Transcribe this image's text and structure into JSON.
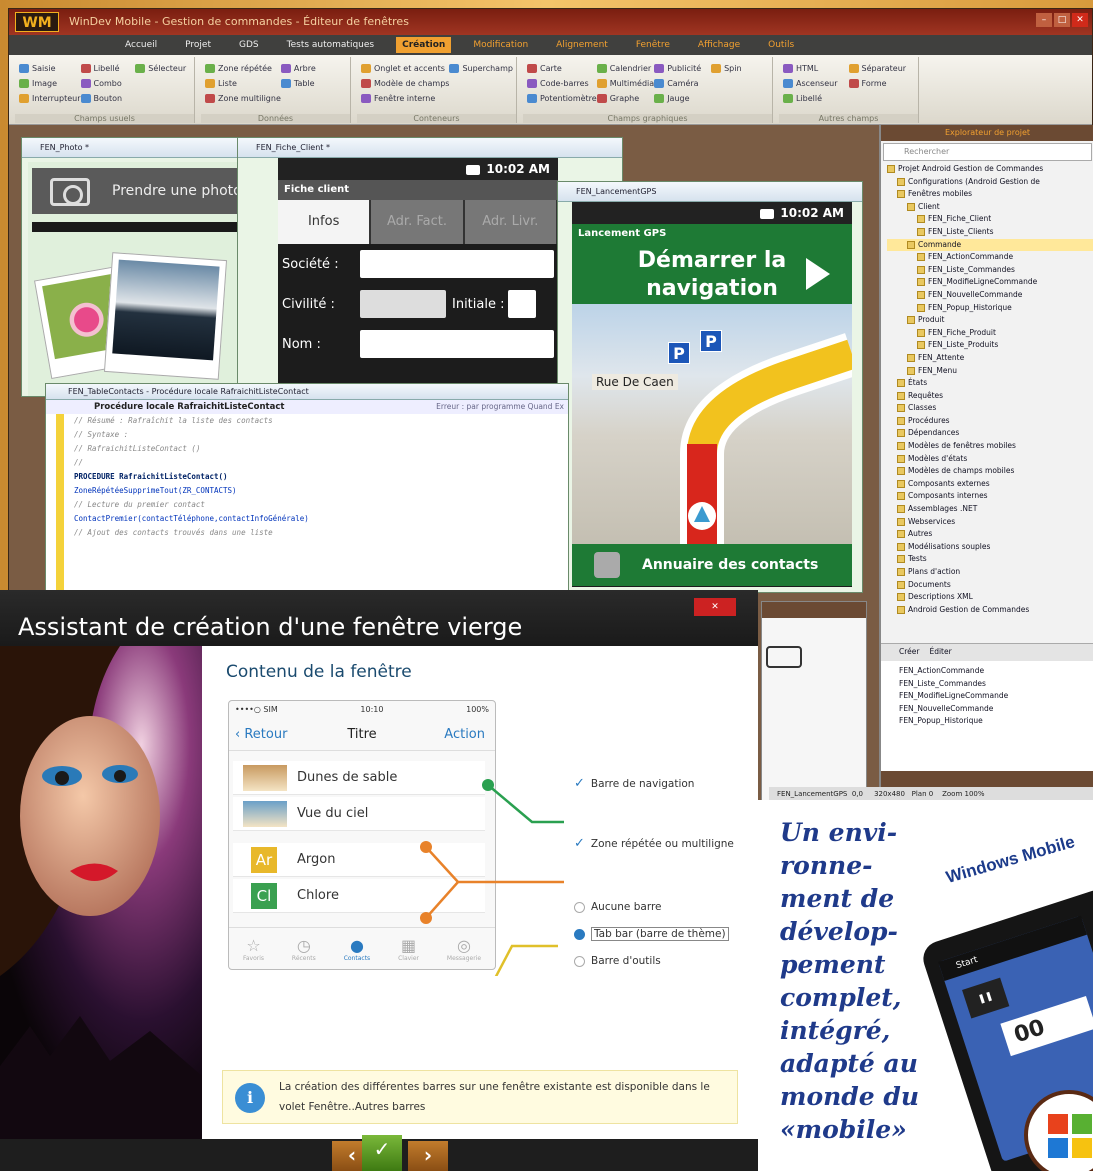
{
  "ide": {
    "title": "WinDev Mobile - Gestion de commandes - Éditeur de fenêtres",
    "logo": "WM",
    "menu": [
      "Accueil",
      "Projet",
      "GDS",
      "Tests automatiques",
      "Création",
      "Modification",
      "Alignement",
      "Fenêtre",
      "Affichage",
      "Outils"
    ],
    "active_menu": "Création",
    "ribbon_groups": [
      {
        "title": "Champs usuels",
        "items": [
          "Saisie",
          "Image",
          "Interrupteur",
          "Libellé",
          "Combo",
          "Bouton",
          "Sélecteur"
        ]
      },
      {
        "title": "Données",
        "items": [
          "Zone répétée",
          "Liste",
          "Zone multiligne",
          "Arbre",
          "Table"
        ]
      },
      {
        "title": "Conteneurs",
        "items": [
          "Onglet et accents",
          "Modèle de champs",
          "Fenêtre interne",
          "Superchamp"
        ]
      },
      {
        "title": "Champs graphiques",
        "items": [
          "Carte",
          "Code-barres",
          "Potentiomètre",
          "Calendrier",
          "Multimédia",
          "Graphe",
          "Publicité",
          "Caméra",
          "Jauge",
          "Spin"
        ]
      },
      {
        "title": "Autres champs",
        "items": [
          "HTML",
          "Ascenseur",
          "Libellé",
          "Séparateur",
          "Forme"
        ]
      }
    ]
  },
  "windows": {
    "photo": {
      "title": "FEN_Photo *",
      "camera_label": "Prendre une photo"
    },
    "client": {
      "title": "FEN_Fiche_Client *",
      "time": "10:02 AM",
      "appbar": "Fiche client",
      "tabs": [
        "Infos",
        "Adr. Fact.",
        "Adr. Livr."
      ],
      "fields": [
        "Société :",
        "Civilité :",
        "Nom :"
      ],
      "initiale": "Initiale :"
    },
    "gps": {
      "title": "FEN_LancementGPS",
      "time": "10:02 AM",
      "appbar": "Lancement GPS",
      "button_line1": "Démarrer la",
      "button_line2": "navigation",
      "street": "Rue De Caen",
      "contacts": "Annuaire des contacts"
    },
    "code": {
      "title": "FEN_TableContacts - Procédure locale RafraichitListeContact",
      "header": "Procédure locale RafraichitListeContact",
      "header_right": "Erreur : par programme   Quand Ex",
      "lines": [
        {
          "t": "// Résumé : Rafraîchit la liste des contacts",
          "c": "cm"
        },
        {
          "t": "// Syntaxe :",
          "c": "cm"
        },
        {
          "t": "// RafraichitListeContact ()",
          "c": "cm"
        },
        {
          "t": "//",
          "c": "cm"
        },
        {
          "t": "PROCEDURE RafraichitListeContact()",
          "c": "kw"
        },
        {
          "t": "",
          "c": ""
        },
        {
          "t": "ZoneRépétéeSupprimeTout(ZR_CONTACTS)",
          "c": "fn"
        },
        {
          "t": "",
          "c": ""
        },
        {
          "t": "// Lecture du premier contact",
          "c": "cm"
        },
        {
          "t": "ContactPremier(contactTéléphone,contactInfoGénérale)",
          "c": "fn"
        },
        {
          "t": "",
          "c": ""
        },
        {
          "t": "// Ajout des contacts trouvés dans une liste",
          "c": "cm"
        }
      ]
    }
  },
  "explorer": {
    "title": "Explorateur de projet",
    "search_placeholder": "Rechercher",
    "tree": [
      "Projet Android Gestion de Commandes",
      "Configurations (Android Gestion de",
      "Fenêtres mobiles",
      "Client",
      "FEN_Fiche_Client",
      "FEN_Liste_Clients",
      "Commande",
      "FEN_ActionCommande",
      "FEN_Liste_Commandes",
      "FEN_ModifieLigneCommande",
      "FEN_NouvelleCommande",
      "FEN_Popup_Historique",
      "Produit",
      "FEN_Fiche_Produit",
      "FEN_Liste_Produits",
      "FEN_Attente",
      "FEN_Menu",
      "États",
      "Requêtes",
      "Classes",
      "Procédures",
      "Dépendances",
      "Modèles de fenêtres mobiles",
      "Modèles d'états",
      "Modèles de champs mobiles",
      "Composants externes",
      "Composants internes",
      "Assemblages .NET",
      "Webservices",
      "Autres",
      "Modélisations souples",
      "Tests",
      "Plans d'action",
      "Documents",
      "Descriptions XML",
      "Android Gestion de Commandes"
    ],
    "selected": "Commande",
    "bottom_buttons": [
      "Créer",
      "Éditer"
    ],
    "bottom_list": [
      "FEN_ActionCommande",
      "FEN_Liste_Commandes",
      "FEN_ModifieLigneCommande",
      "FEN_NouvelleCommande",
      "FEN_Popup_Historique"
    ],
    "status": "FEN_LancementGPS  0,0     320x480   Plan 0    Zoom 100%"
  },
  "wizard": {
    "title": "Assistant de création d'une fenêtre vierge",
    "close": "✕",
    "heading": "Contenu de la fenêtre",
    "iphone": {
      "status_left": "••••○ SIM",
      "status_time": "10:10",
      "status_right": "100%",
      "back": "Retour",
      "nav_title": "Titre",
      "action": "Action",
      "rows": [
        {
          "label": "Dunes de sable",
          "thumb": "#c89a60"
        },
        {
          "label": "Vue du ciel",
          "thumb": "#6aa0c8"
        },
        {
          "label": "Argon",
          "badge": "Ar",
          "color": "#e8b82a"
        },
        {
          "label": "Chlore",
          "badge": "Cl",
          "color": "#3aa050"
        }
      ],
      "tabbar": [
        "Favoris",
        "Récents",
        "Contacts",
        "Clavier",
        "Messagerie"
      ]
    },
    "options": [
      {
        "type": "check",
        "label": "Barre de navigation"
      },
      {
        "type": "check",
        "label": "Zone répétée ou multiligne"
      },
      {
        "type": "radio",
        "label": "Aucune barre",
        "on": false
      },
      {
        "type": "radio",
        "label": "Tab bar (barre de thème)",
        "on": true
      },
      {
        "type": "radio",
        "label": "Barre d'outils",
        "on": false
      }
    ],
    "info": "La création des différentes barres sur une fenêtre existante est disponible dans le volet Fenêtre..Autres barres",
    "nav": {
      "prev": "‹",
      "ok": "✓",
      "next": "›"
    }
  },
  "side": {
    "slogan": "Un envi-\nronne-\nment de\ndévelop-\npement\ncomplet,\nintégré,\nadapté au\nmonde du\n«mobile»",
    "device_label": "Windows Mobile",
    "device_start": "Start",
    "device_time": "00"
  },
  "colors": {
    "accent": "#f0a030",
    "gps_green": "#1e7a35",
    "link_blue": "#2a7ac0",
    "slogan_blue": "#1f3a8a"
  }
}
